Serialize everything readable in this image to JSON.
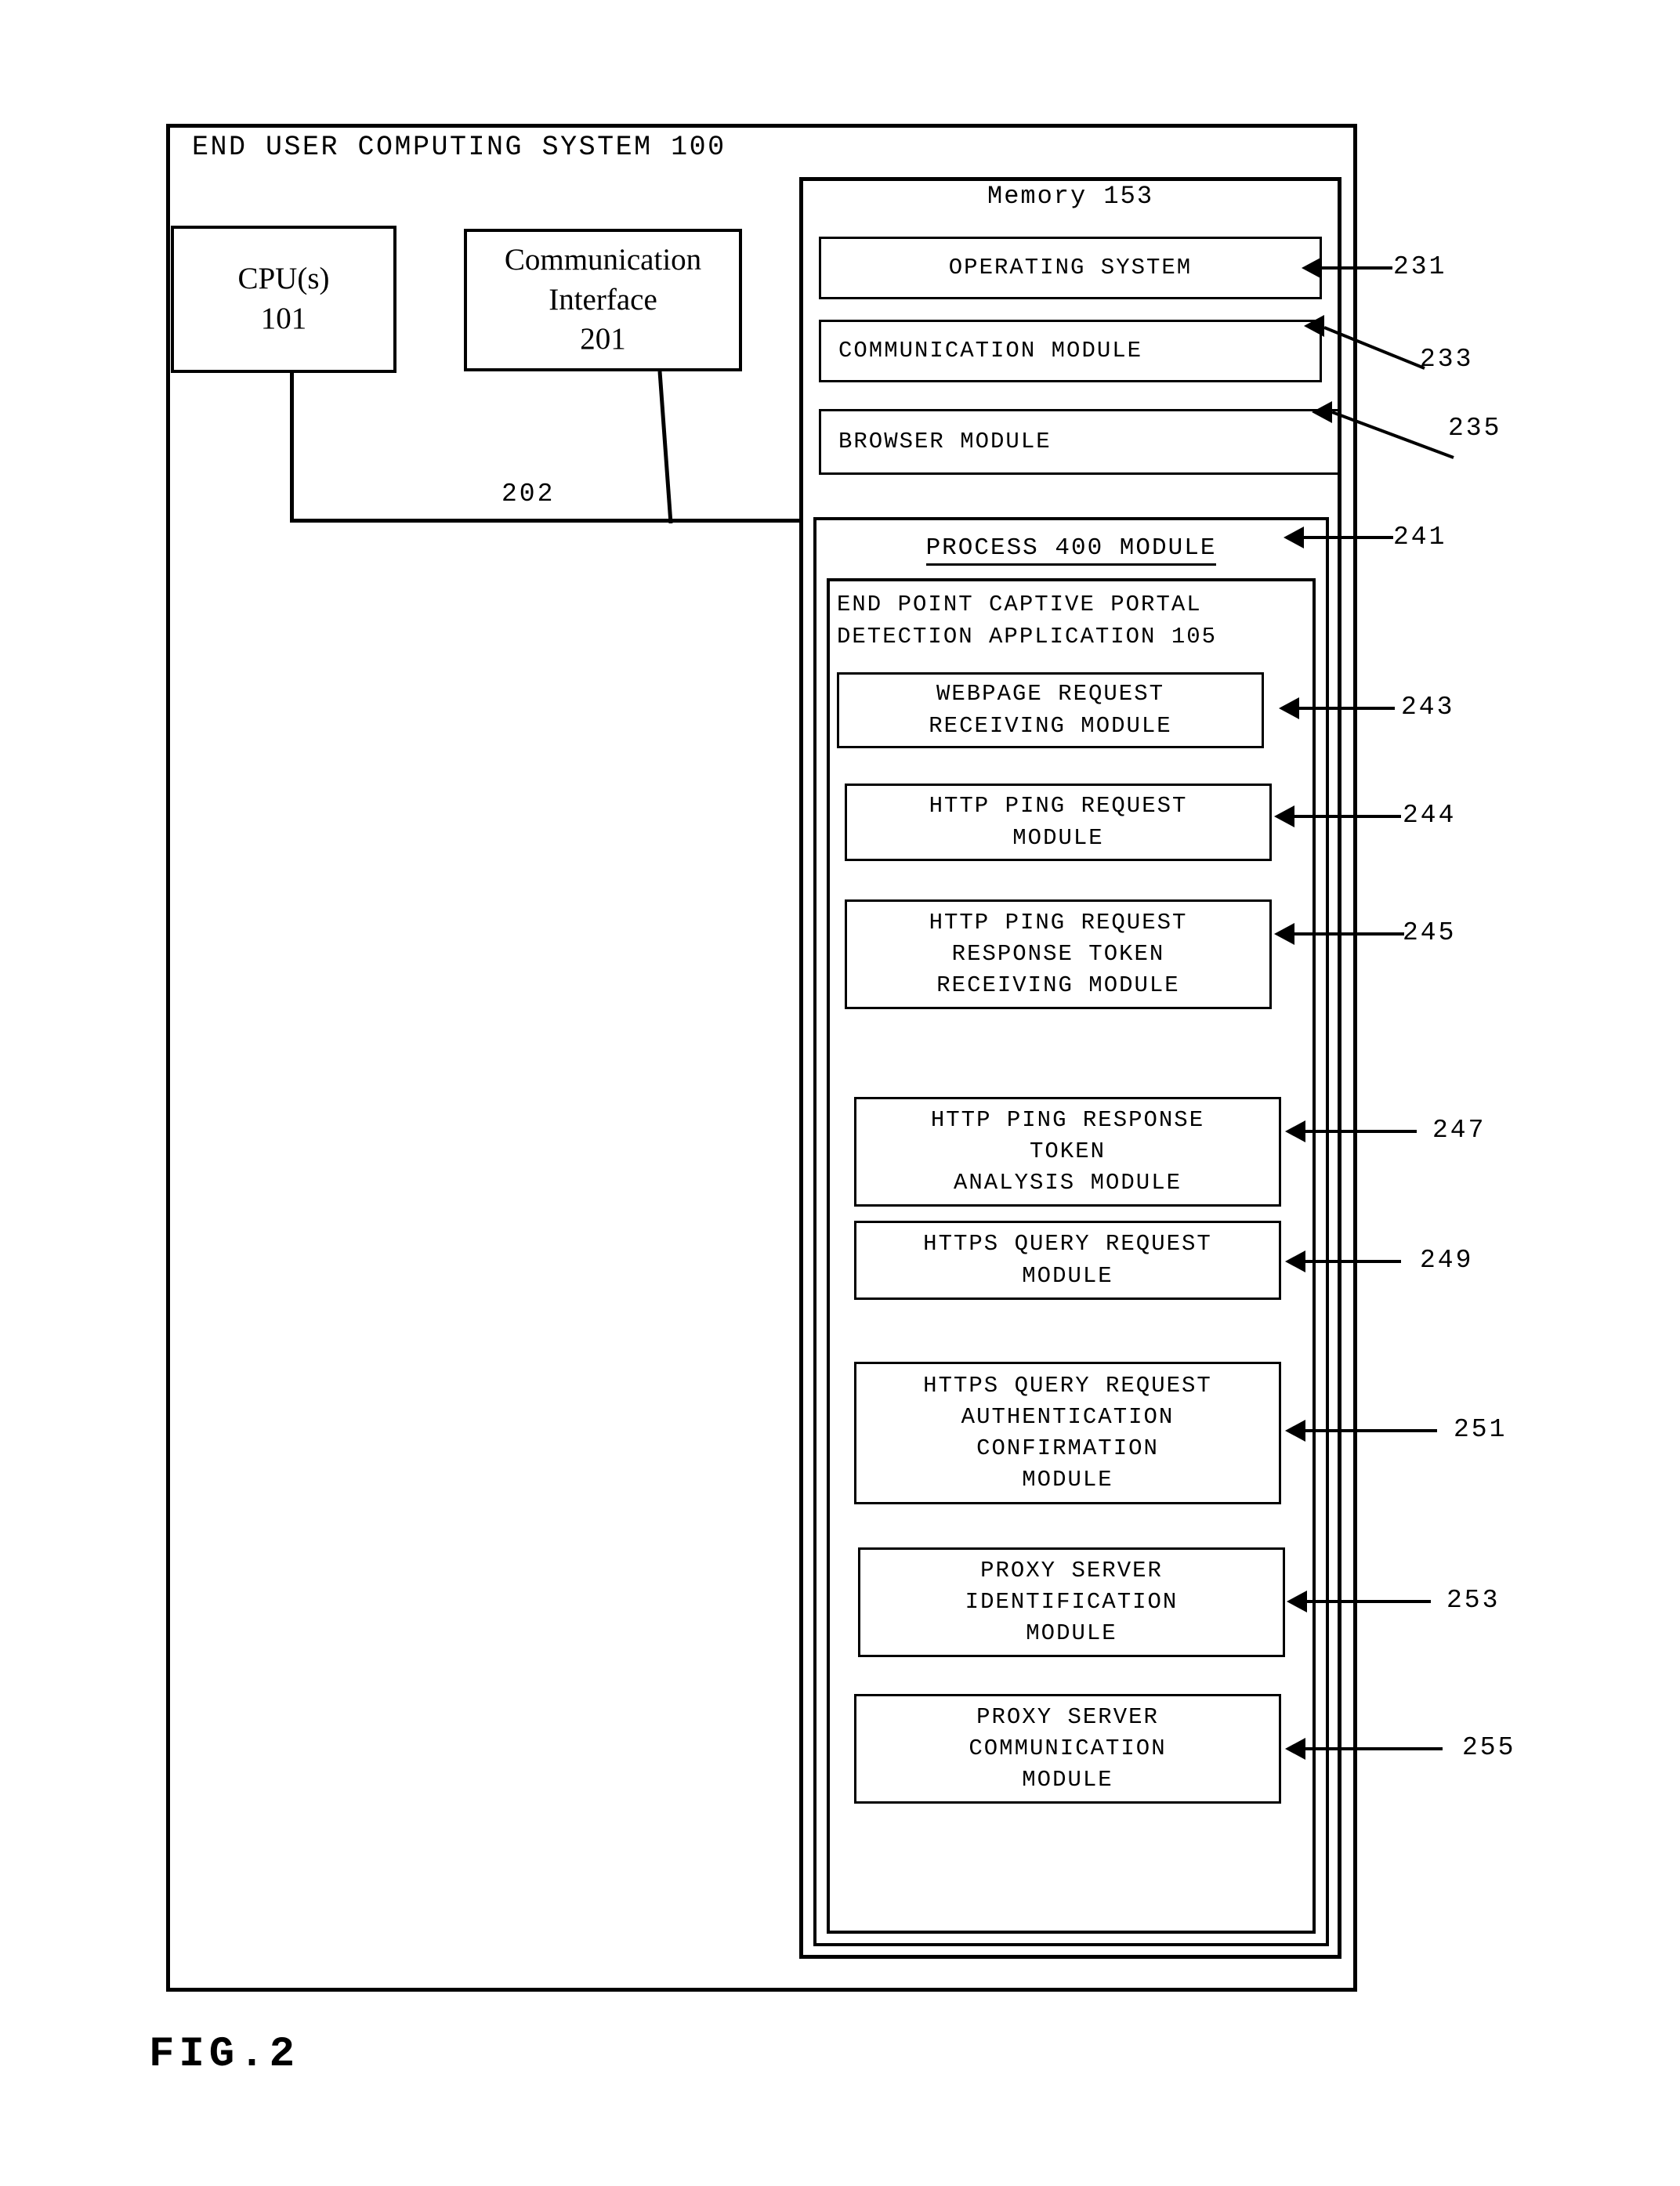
{
  "figure": {
    "label": "FIG.2",
    "system_title": "END USER COMPUTING SYSTEM 100"
  },
  "hardware": {
    "cpu": {
      "name": "CPU(s)",
      "ref": "101"
    },
    "comm_interface": {
      "name": "Communication Interface",
      "line1": "Communication",
      "line2": "Interface",
      "ref": "201"
    },
    "bus_ref": "202"
  },
  "memory": {
    "title": "Memory 153",
    "modules": [
      {
        "label": "OPERATING SYSTEM",
        "ref": "231"
      },
      {
        "label": "COMMUNICATION MODULE",
        "ref": "233"
      },
      {
        "label": "BROWSER MODULE",
        "ref": "235"
      }
    ]
  },
  "process_module": {
    "title": "PROCESS 400 MODULE",
    "ref": "241",
    "application": {
      "title_line1": "END POINT CAPTIVE PORTAL",
      "title_line2": "DETECTION APPLICATION 105",
      "modules": [
        {
          "line1": "WEBPAGE REQUEST",
          "line2": "RECEIVING MODULE",
          "line3": "",
          "line4": "",
          "ref": "243"
        },
        {
          "line1": "HTTP PING REQUEST",
          "line2": "MODULE",
          "line3": "",
          "line4": "",
          "ref": "244"
        },
        {
          "line1": "HTTP PING REQUEST",
          "line2": "RESPONSE TOKEN",
          "line3": "RECEIVING MODULE",
          "line4": "",
          "ref": "245"
        },
        {
          "line1": "HTTP PING RESPONSE",
          "line2": "TOKEN",
          "line3": "ANALYSIS MODULE",
          "line4": "",
          "ref": "247"
        },
        {
          "line1": "HTTPS QUERY REQUEST",
          "line2": "MODULE",
          "line3": "",
          "line4": "",
          "ref": "249"
        },
        {
          "line1": "HTTPS QUERY REQUEST",
          "line2": "AUTHENTICATION",
          "line3": "CONFIRMATION",
          "line4": "MODULE",
          "ref": "251"
        },
        {
          "line1": "PROXY SERVER",
          "line2": "IDENTIFICATION",
          "line3": "MODULE",
          "line4": "",
          "ref": "253"
        },
        {
          "line1": "PROXY SERVER",
          "line2": "COMMUNICATION",
          "line3": "MODULE",
          "line4": "",
          "ref": "255"
        }
      ]
    }
  }
}
